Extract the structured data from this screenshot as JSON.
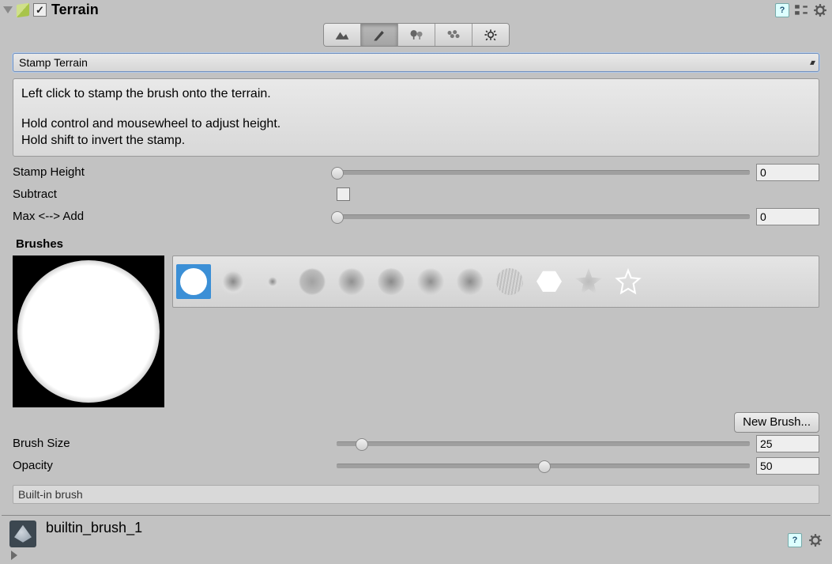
{
  "header": {
    "title": "Terrain",
    "enabled": true
  },
  "modes": [
    "terrain",
    "paint",
    "tree",
    "detail",
    "settings"
  ],
  "active_mode": 1,
  "dropdown": {
    "value": "Stamp Terrain"
  },
  "help": {
    "l1": "Left click to stamp the brush onto the terrain.",
    "l2": "Hold control and mousewheel to adjust height.",
    "l3": "Hold shift to invert the stamp."
  },
  "settings": {
    "stamp_height": {
      "label": "Stamp Height",
      "value": "0",
      "pct": 0
    },
    "subtract": {
      "label": "Subtract",
      "checked": false
    },
    "max_add": {
      "label": "Max <--> Add",
      "value": "0",
      "pct": 0
    }
  },
  "brushes": {
    "label": "Brushes",
    "selected": 0,
    "new_btn": "New Brush...",
    "brush_size": {
      "label": "Brush Size",
      "value": "25",
      "pct": 6
    },
    "opacity": {
      "label": "Opacity",
      "value": "50",
      "pct": 50
    }
  },
  "footer": {
    "label": "Built-in brush"
  },
  "asset": {
    "name": "builtin_brush_1"
  }
}
